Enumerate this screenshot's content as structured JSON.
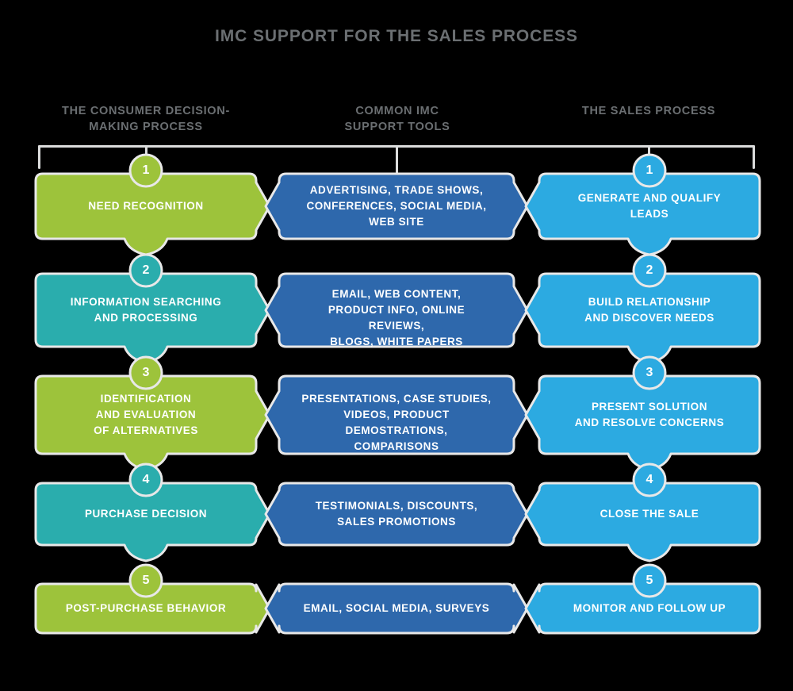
{
  "title": "IMC SUPPORT FOR THE SALES PROCESS",
  "colors": {
    "background": "#000000",
    "title_text": "#6b6f72",
    "header_text": "#6b6f72",
    "bracket": "#dcdddd",
    "card_stroke": "#e8e8e8",
    "green": "#9DC33B",
    "teal": "#2AADAD",
    "dark_blue": "#2E68AC",
    "light_blue": "#2CAAE1",
    "label_text": "#ffffff"
  },
  "columns": [
    {
      "id": "consumer-decision",
      "header": "THE CONSUMER DECISION-\nMAKING PROCESS"
    },
    {
      "id": "imc-support-tools",
      "header": "COMMON IMC\nSUPPORT TOOLS"
    },
    {
      "id": "sales-process",
      "header": "THE SALES PROCESS"
    }
  ],
  "headers": {
    "col1_line1": "THE CONSUMER DECISION-",
    "col1_line2": "MAKING PROCESS",
    "col2_line1": "COMMON IMC",
    "col2_line2": "SUPPORT TOOLS",
    "col3_line1": "THE SALES PROCESS"
  },
  "rows": [
    {
      "step": "1",
      "left": {
        "text": "NEED RECOGNITION",
        "color": "#9DC33B",
        "badge": "1"
      },
      "middle": {
        "text": "ADVERTISING, TRADE SHOWS,\nCONFERENCES, SOCIAL MEDIA,\nWEB SITE",
        "color": "#2E68AC"
      },
      "right": {
        "text": "GENERATE AND QUALIFY\nLEADS",
        "color": "#2CAAE1",
        "badge": "1"
      }
    },
    {
      "step": "2",
      "left": {
        "text": "INFORMATION SEARCHING\nAND PROCESSING",
        "color": "#2AADAD",
        "badge": "2"
      },
      "middle": {
        "text": "EMAIL, WEB CONTENT,\nPRODUCT INFO, ONLINE REVIEWS,\nBLOGS, WHITE PAPERS",
        "color": "#2E68AC"
      },
      "right": {
        "text": "BUILD RELATIONSHIP\nAND DISCOVER NEEDS",
        "color": "#2CAAE1",
        "badge": "2"
      }
    },
    {
      "step": "3",
      "left": {
        "text": "IDENTIFICATION\nAND EVALUATION\nOF ALTERNATIVES",
        "color": "#9DC33B",
        "badge": "3"
      },
      "middle": {
        "text": "PRESENTATIONS, CASE STUDIES,\nVIDEOS, PRODUCT DEMOSTRATIONS,\nCOMPARISONS",
        "color": "#2E68AC"
      },
      "right": {
        "text": "PRESENT SOLUTION\nAND RESOLVE CONCERNS",
        "color": "#2CAAE1",
        "badge": "3"
      }
    },
    {
      "step": "4",
      "left": {
        "text": "PURCHASE DECISION",
        "color": "#2AADAD",
        "badge": "4"
      },
      "middle": {
        "text": "TESTIMONIALS, DISCOUNTS,\nSALES PROMOTIONS",
        "color": "#2E68AC"
      },
      "right": {
        "text": "CLOSE THE SALE",
        "color": "#2CAAE1",
        "badge": "4"
      }
    },
    {
      "step": "5",
      "left": {
        "text": "POST-PURCHASE BEHAVIOR",
        "color": "#9DC33B",
        "badge": "5"
      },
      "middle": {
        "text": "EMAIL, SOCIAL MEDIA, SURVEYS",
        "color": "#2E68AC"
      },
      "right": {
        "text": "MONITOR AND FOLLOW UP",
        "color": "#2CAAE1",
        "badge": "5"
      }
    }
  ],
  "chart_data": {
    "type": "table",
    "title": "IMC SUPPORT FOR THE SALES PROCESS",
    "categories": [
      "1",
      "2",
      "3",
      "4",
      "5"
    ],
    "series": [
      {
        "name": "THE CONSUMER DECISION-MAKING PROCESS",
        "values": [
          "NEED RECOGNITION",
          "INFORMATION SEARCHING AND PROCESSING",
          "IDENTIFICATION AND EVALUATION OF ALTERNATIVES",
          "PURCHASE DECISION",
          "POST-PURCHASE BEHAVIOR"
        ]
      },
      {
        "name": "COMMON IMC SUPPORT TOOLS",
        "values": [
          "ADVERTISING, TRADE SHOWS, CONFERENCES, SOCIAL MEDIA, WEB SITE",
          "EMAIL, WEB CONTENT, PRODUCT INFO, ONLINE REVIEWS, BLOGS, WHITE PAPERS",
          "PRESENTATIONS, CASE STUDIES, VIDEOS, PRODUCT DEMOSTRATIONS, COMPARISONS",
          "TESTIMONIALS, DISCOUNTS, SALES PROMOTIONS",
          "EMAIL, SOCIAL MEDIA, SURVEYS"
        ]
      },
      {
        "name": "THE SALES PROCESS",
        "values": [
          "GENERATE AND QUALIFY LEADS",
          "BUILD RELATIONSHIP AND DISCOVER NEEDS",
          "PRESENT SOLUTION AND RESOLVE CONCERNS",
          "CLOSE THE SALE",
          "MONITOR AND FOLLOW UP"
        ]
      }
    ]
  }
}
